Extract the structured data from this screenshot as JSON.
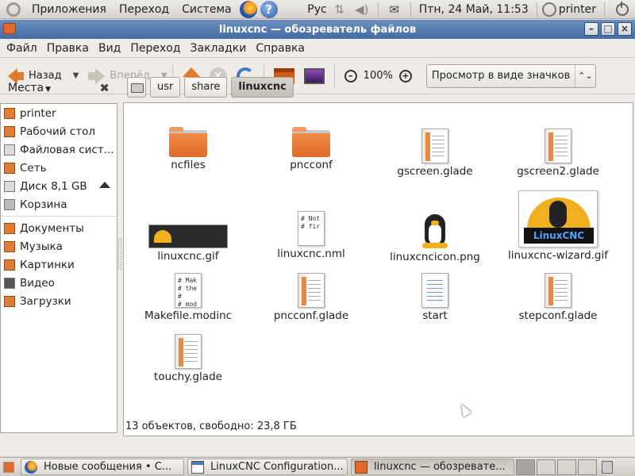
{
  "top_panel": {
    "menus": [
      "Приложения",
      "Переход",
      "Система"
    ],
    "keyboard_layout": "Рус",
    "datetime": "Птн, 24 Май, 11:53",
    "user": "printer"
  },
  "window": {
    "title": "linuxcnc — обозреватель файлов",
    "menubar": [
      "Файл",
      "Правка",
      "Вид",
      "Переход",
      "Закладки",
      "Справка"
    ],
    "toolbar": {
      "back_label": "Назад",
      "forward_label": "Вперёд",
      "zoom_value": "100%",
      "view_mode": "Просмотр в виде значков"
    },
    "sidebar": {
      "title": "Места",
      "places": [
        {
          "label": "printer",
          "icon": "home-icon"
        },
        {
          "label": "Рабочий стол",
          "icon": "desktop-icon"
        },
        {
          "label": "Файловая сист...",
          "icon": "filesystem-icon"
        },
        {
          "label": "Сеть",
          "icon": "network-icon"
        },
        {
          "label": "Диск 8,1 GB",
          "icon": "disk-icon"
        },
        {
          "label": "Корзина",
          "icon": "trash-icon"
        }
      ],
      "bookmarks": [
        {
          "label": "Документы",
          "icon": "folder-icon"
        },
        {
          "label": "Музыка",
          "icon": "folder-music-icon"
        },
        {
          "label": "Картинки",
          "icon": "folder-pictures-icon"
        },
        {
          "label": "Видео",
          "icon": "folder-video-icon"
        },
        {
          "label": "Загрузки",
          "icon": "folder-downloads-icon"
        }
      ]
    },
    "breadcrumb": [
      "usr",
      "share",
      "linuxcnc"
    ],
    "files": [
      {
        "name": "ncfiles",
        "kind": "folder"
      },
      {
        "name": "pncconf",
        "kind": "folder"
      },
      {
        "name": "gscreen.glade",
        "kind": "glade"
      },
      {
        "name": "gscreen2.glade",
        "kind": "glade"
      },
      {
        "name": "linuxcnc.gif",
        "kind": "gif"
      },
      {
        "name": "linuxcnc.nml",
        "kind": "text",
        "preview": "# Not\n# fir"
      },
      {
        "name": "linuxcncicon.png",
        "kind": "tux"
      },
      {
        "name": "linuxcnc-wizard.gif",
        "kind": "wizard",
        "thumb_text": "LinuxCNC"
      },
      {
        "name": "Makefile.modinc",
        "kind": "text",
        "preview": "# Mak\n# the\n#\n# mod"
      },
      {
        "name": "pncconf.glade",
        "kind": "glade"
      },
      {
        "name": "start",
        "kind": "script"
      },
      {
        "name": "stepconf.glade",
        "kind": "glade"
      },
      {
        "name": "touchy.glade",
        "kind": "glade"
      }
    ],
    "status": "13 объектов, свободно: 23,8 ГБ"
  },
  "taskbar": {
    "tasks": [
      {
        "label": "Новые сообщения • С...",
        "icon": "firefox-icon"
      },
      {
        "label": "LinuxCNC Configuration...",
        "icon": "window-icon"
      },
      {
        "label": "linuxcnc — обозревате...",
        "icon": "folder-icon"
      }
    ]
  }
}
